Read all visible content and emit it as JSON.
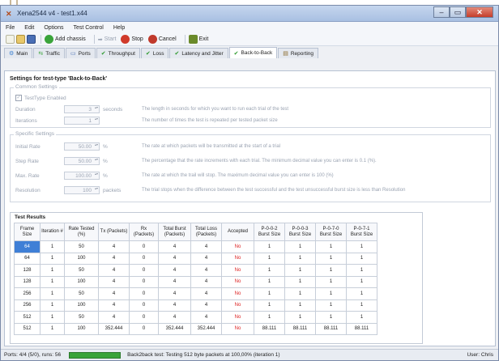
{
  "window": {
    "title": "Xena2544 v4 - test1.x44"
  },
  "menu": [
    "File",
    "Edit",
    "Options",
    "Test Control",
    "Help"
  ],
  "toolbar": {
    "add_chassis": "Add chassis",
    "start": "Start",
    "stop": "Stop",
    "cancel": "Cancel",
    "exit": "Exit"
  },
  "tabs": [
    {
      "label": "Main",
      "icon": "gear-icon"
    },
    {
      "label": "Traffic",
      "icon": "traffic-icon"
    },
    {
      "label": "Ports",
      "icon": "ports-icon"
    },
    {
      "label": "Throughput",
      "icon": "check-icon"
    },
    {
      "label": "Loss",
      "icon": "check-icon"
    },
    {
      "label": "Latency and Jitter",
      "icon": "check-icon"
    },
    {
      "label": "Back-to-Back",
      "icon": "check-icon",
      "active": true
    },
    {
      "label": "Reporting",
      "icon": "report-icon"
    }
  ],
  "settings_title": "Settings for test-type 'Back-to-Back'",
  "common": {
    "group_title": "Common Settings",
    "enabled_label": "TestType Enabled",
    "enabled": true,
    "duration_label": "Duration",
    "duration_value": "3",
    "duration_unit": "seconds",
    "duration_desc": "The length in seconds for which you want to run each trial of the test",
    "iterations_label": "Iterations",
    "iterations_value": "1",
    "iterations_desc": "The number of times the test is repeated per tested packet size"
  },
  "specific": {
    "group_title": "Specific Settings",
    "initial_label": "Initial Rate",
    "initial_value": "50.00",
    "initial_unit": "%",
    "initial_desc": "The rate at which packets will be transmitted at the start of a trial",
    "step_label": "Step Rate",
    "step_value": "50.00",
    "step_unit": "%",
    "step_desc": "The percentage that the rate increments with each trial. The minimum decimal value you can enter is 0.1 (%).",
    "max_label": "Max. Rate",
    "max_value": "100.00",
    "max_unit": "%",
    "max_desc": "The rate at which the trail will stop. The maximum decimal value you can enter is 100 (%)",
    "resolution_label": "Resolution",
    "resolution_value": "100",
    "resolution_unit": "packets",
    "resolution_desc": "The trial stops when the difference between the test successful and the test unsuccessful burst size is less than Resolution"
  },
  "results": {
    "title": "Test Results",
    "headers": [
      "Frame Size",
      "Iteration #",
      "Rate Tested (%)",
      "Tx (Packets)",
      "Rx (Packets)",
      "Total Burst (Packets)",
      "Total Loss (Packets)",
      "Accepted",
      "P-0-0-2 Burst Size",
      "P-0-0-3 Burst Size",
      "P-0-7-0 Burst Size",
      "P-0-7-1 Burst Size"
    ],
    "rows": [
      [
        "64",
        "1",
        "50",
        "4",
        "0",
        "4",
        "4",
        "No",
        "1",
        "1",
        "1",
        "1"
      ],
      [
        "64",
        "1",
        "100",
        "4",
        "0",
        "4",
        "4",
        "No",
        "1",
        "1",
        "1",
        "1"
      ],
      [
        "128",
        "1",
        "50",
        "4",
        "0",
        "4",
        "4",
        "No",
        "1",
        "1",
        "1",
        "1"
      ],
      [
        "128",
        "1",
        "100",
        "4",
        "0",
        "4",
        "4",
        "No",
        "1",
        "1",
        "1",
        "1"
      ],
      [
        "256",
        "1",
        "50",
        "4",
        "0",
        "4",
        "4",
        "No",
        "1",
        "1",
        "1",
        "1"
      ],
      [
        "256",
        "1",
        "100",
        "4",
        "0",
        "4",
        "4",
        "No",
        "1",
        "1",
        "1",
        "1"
      ],
      [
        "512",
        "1",
        "50",
        "4",
        "0",
        "4",
        "4",
        "No",
        "1",
        "1",
        "1",
        "1"
      ],
      [
        "512",
        "1",
        "100",
        "352.444",
        "0",
        "352.444",
        "352.444",
        "No",
        "88.111",
        "88.111",
        "88.111",
        "88.111"
      ]
    ]
  },
  "status": {
    "ports": "Ports: 4/4 (5/0), runs: 56",
    "progress_fraction": 1.0,
    "message": "Back2back test: Testing 512 byte packets at 100,00% (iteration 1)",
    "user": "User: Chris"
  }
}
